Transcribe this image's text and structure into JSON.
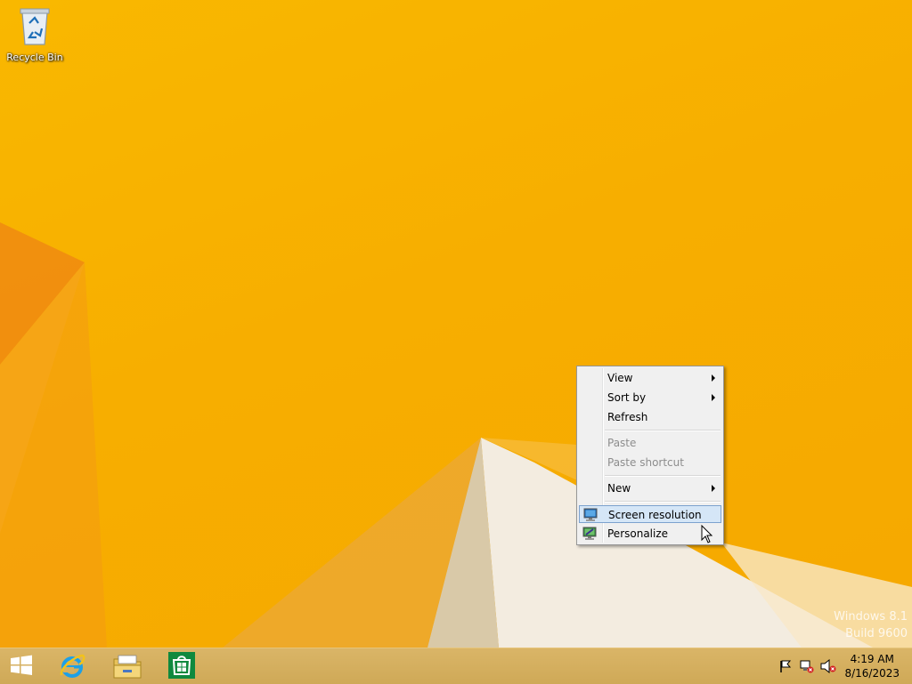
{
  "desktop": {
    "icons": [
      {
        "label": "Recycle Bin",
        "icon": "recycle-bin-icon"
      }
    ],
    "watermark": {
      "line1": "Windows 8.1",
      "line2": "Build 9600"
    }
  },
  "context_menu": {
    "items": [
      {
        "label": "View",
        "enabled": true,
        "submenu": true
      },
      {
        "label": "Sort by",
        "enabled": true,
        "submenu": true
      },
      {
        "label": "Refresh",
        "enabled": true,
        "submenu": false
      },
      {
        "label": "Paste",
        "enabled": false,
        "submenu": false
      },
      {
        "label": "Paste shortcut",
        "enabled": false,
        "submenu": false
      },
      {
        "label": "New",
        "enabled": true,
        "submenu": true
      },
      {
        "label": "Screen resolution",
        "enabled": true,
        "submenu": false,
        "icon": "monitor-icon",
        "highlighted": true
      },
      {
        "label": "Personalize",
        "enabled": true,
        "submenu": false,
        "icon": "personalize-icon"
      }
    ]
  },
  "taskbar": {
    "pinned": [
      {
        "name": "start",
        "icon": "windows-logo-icon"
      },
      {
        "name": "internet-explorer",
        "icon": "internet-explorer-icon"
      },
      {
        "name": "file-explorer",
        "icon": "file-explorer-icon"
      },
      {
        "name": "store",
        "icon": "store-icon"
      }
    ],
    "tray": [
      "action-center-flag-icon",
      "network-disconnected-icon",
      "speaker-muted-icon"
    ],
    "clock": {
      "time": "4:19 AM",
      "date": "8/16/2023"
    }
  },
  "colors": {
    "wallpaper": "#f9b800",
    "menu_highlight": "#d5e6f7",
    "taskbar": "#d6b05f"
  }
}
